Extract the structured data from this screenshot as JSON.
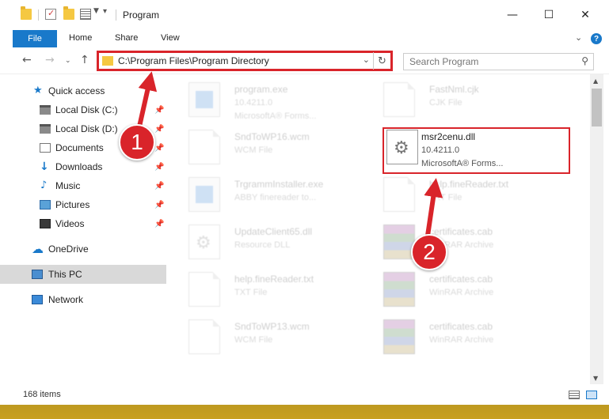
{
  "window": {
    "title": "Program",
    "controls": {
      "minimize": "—",
      "maximize": "☐",
      "close": "✕"
    }
  },
  "ribbon": {
    "tabs": [
      "File",
      "Home",
      "Share",
      "View"
    ],
    "expand_icon": "chevron-down-icon",
    "help_icon": "help-icon"
  },
  "address": {
    "path": "C:\\Program Files\\Program Directory"
  },
  "search": {
    "placeholder": "Search Program"
  },
  "navpane": {
    "items": [
      {
        "label": "Quick access",
        "icon": "star-icon"
      },
      {
        "label": "Local Disk (C:)",
        "icon": "drive-icon",
        "pinned": true
      },
      {
        "label": "Local Disk (D:)",
        "icon": "drive-icon",
        "pinned": true
      },
      {
        "label": "Documents",
        "icon": "documents-icon",
        "pinned": true
      },
      {
        "label": "Downloads",
        "icon": "downloads-icon",
        "pinned": true
      },
      {
        "label": "Music",
        "icon": "music-icon",
        "pinned": true
      },
      {
        "label": "Pictures",
        "icon": "pictures-icon",
        "pinned": true
      },
      {
        "label": "Videos",
        "icon": "videos-icon",
        "pinned": true
      },
      {
        "label": "OneDrive",
        "icon": "cloud-icon"
      },
      {
        "label": "This PC",
        "icon": "computer-icon",
        "selected": true
      },
      {
        "label": "Network",
        "icon": "network-icon"
      }
    ]
  },
  "files": [
    {
      "name": "program.exe",
      "line2": "10.4211.0",
      "line3": "MicrosoftA® Forms...",
      "icon": "exe-icon",
      "highlighted": false
    },
    {
      "name": "FastNml.cjk",
      "line2": "CJK File",
      "line3": "",
      "icon": "file-icon",
      "highlighted": false
    },
    {
      "name": "SndToWP16.wcm",
      "line2": "WCM File",
      "line3": "",
      "icon": "file-icon",
      "highlighted": false
    },
    {
      "name": "msr2cenu.dll",
      "line2": "10.4211.0",
      "line3": "MicrosoftA® Forms...",
      "icon": "dll-gear-icon",
      "highlighted": true
    },
    {
      "name": "TrgrammInstaller.exe",
      "line2": "ABBY finereader to...",
      "line3": "",
      "icon": "installer-icon",
      "highlighted": false
    },
    {
      "name": "help.fineReader.txt",
      "line2": "TXT File",
      "line3": "",
      "icon": "file-icon",
      "highlighted": false
    },
    {
      "name": "UpdateClient65.dll",
      "line2": "Resource DLL",
      "line3": "",
      "icon": "dll-gear-icon",
      "highlighted": false
    },
    {
      "name": "certificates.cab",
      "line2": "WinRAR Archive",
      "line3": "",
      "icon": "archive-icon",
      "highlighted": false
    },
    {
      "name": "help.fineReader.txt",
      "line2": "TXT File",
      "line3": "",
      "icon": "file-icon",
      "highlighted": false
    },
    {
      "name": "certificates.cab",
      "line2": "WinRAR Archive",
      "line3": "",
      "icon": "archive-icon",
      "highlighted": false
    },
    {
      "name": "SndToWP13.wcm",
      "line2": "WCM File",
      "line3": "",
      "icon": "file-icon",
      "highlighted": false
    },
    {
      "name": "certificates.cab",
      "line2": "WinRAR Archive",
      "line3": "",
      "icon": "archive-icon",
      "highlighted": false
    }
  ],
  "status": {
    "item_count": "168 items"
  },
  "callouts": [
    "1",
    "2"
  ],
  "colors": {
    "accent": "#1979ca",
    "highlight_red": "#d9242a",
    "selected_nav": "#d9d9d9"
  }
}
